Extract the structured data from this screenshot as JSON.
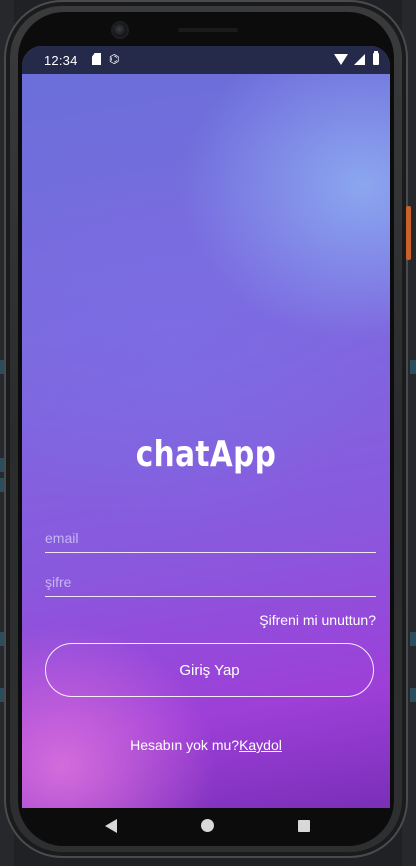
{
  "status_bar": {
    "time": "12:34",
    "debug_glyph": "⌬",
    "icons": [
      "sd-card-icon",
      "debug-icon",
      "wifi-icon",
      "signal-icon",
      "battery-icon"
    ]
  },
  "app": {
    "logo": "chatApp"
  },
  "login_form": {
    "email_placeholder": "email",
    "password_placeholder": "şifre",
    "forgot_password": "Şifreni mi unuttun?",
    "login_button": "Giriş Yap",
    "no_account_text": "Hesabın yok mu?",
    "signup_link": "Kaydol"
  },
  "nav_bar": {
    "icons": [
      "back-icon",
      "home-icon",
      "recents-icon"
    ]
  },
  "colors": {
    "gradient_top": "#6a6fd9",
    "gradient_bottom": "#9d3fd8",
    "highlight_blue": "#8caaf0",
    "highlight_pink": "#d76edc",
    "text": "#ffffff"
  }
}
